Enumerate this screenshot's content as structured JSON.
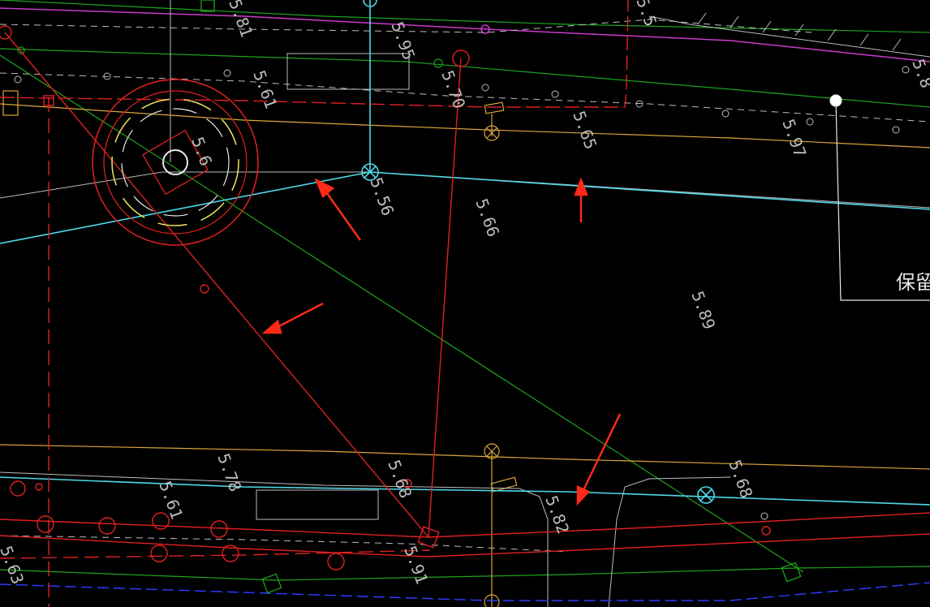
{
  "drawing": {
    "background": "#000000",
    "colors": {
      "red": "#e02020",
      "green": "#1fa31f",
      "cyan": "#4fd8e8",
      "white": "#e8e8e8",
      "gray": "#bdbdbd",
      "orange": "#d9a53a",
      "magenta": "#c83cc8",
      "yellow": "#f2e85a",
      "blue": "#2a3cff",
      "annotation": "#ff2a1a"
    },
    "elevations": [
      {
        "id": "e1",
        "text": "5.95"
      },
      {
        "id": "e2",
        "text": "5.61"
      },
      {
        "id": "e3",
        "text": "5.70"
      },
      {
        "id": "e4",
        "text": "5.65"
      },
      {
        "id": "e5",
        "text": "5.97"
      },
      {
        "id": "e6",
        "text": "5.56"
      },
      {
        "id": "e7",
        "text": "5.66"
      },
      {
        "id": "e8",
        "text": "5.89"
      },
      {
        "id": "e9",
        "text": "5.68"
      },
      {
        "id": "e10",
        "text": "5.82"
      },
      {
        "id": "e11",
        "text": "5.68"
      },
      {
        "id": "e12",
        "text": "5.78"
      },
      {
        "id": "e13",
        "text": "5.61"
      },
      {
        "id": "e14",
        "text": "5.91"
      },
      {
        "id": "e15",
        "text": "5.63"
      },
      {
        "id": "e16",
        "text": "5.8"
      },
      {
        "id": "e17",
        "text": "5.81"
      },
      {
        "id": "e18",
        "text": "5.6"
      },
      {
        "id": "e19",
        "text": "5.5"
      }
    ],
    "label_retain": "保留现"
  }
}
